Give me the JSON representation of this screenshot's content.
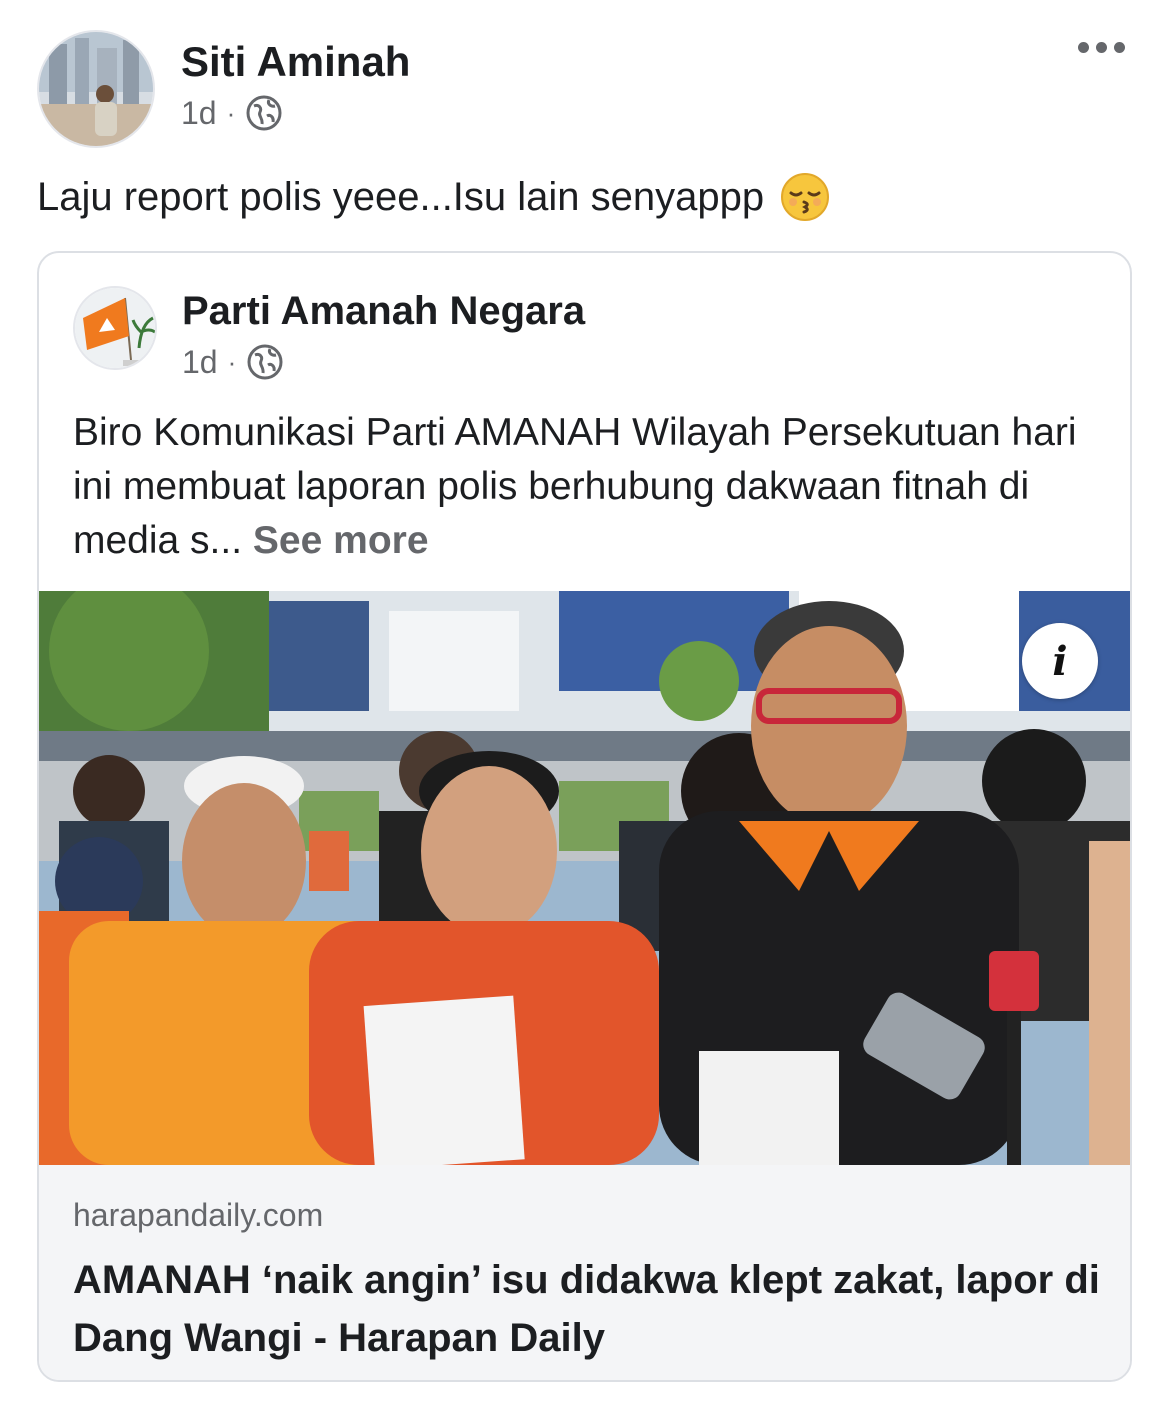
{
  "post": {
    "author": "Siti Aminah",
    "time": "1d",
    "separator": "·",
    "privacy_icon": "globe-icon",
    "text": "Laju report polis yeee...Isu lain senyappp",
    "emoji": "kissing-face-closed-eyes-emoji"
  },
  "shared": {
    "page_name": "Parti Amanah Negara",
    "time": "1d",
    "separator": "·",
    "privacy_icon": "globe-icon",
    "text": "Biro Komunikasi Parti AMANAH Wilayah Persekutuan hari ini membuat laporan polis berhubung dakwaan fitnah di media s...",
    "see_more": "See more"
  },
  "link": {
    "domain": "harapandaily.com",
    "title": "AMANAH ‘naik angin’ isu didakwa klept zakat, lapor di Dang Wangi - Harapan Daily",
    "info_label": "i"
  },
  "colors": {
    "secondary_text": "#65676b",
    "link_footer_bg": "#f4f5f7",
    "amanah_orange": "#f07a1e"
  }
}
